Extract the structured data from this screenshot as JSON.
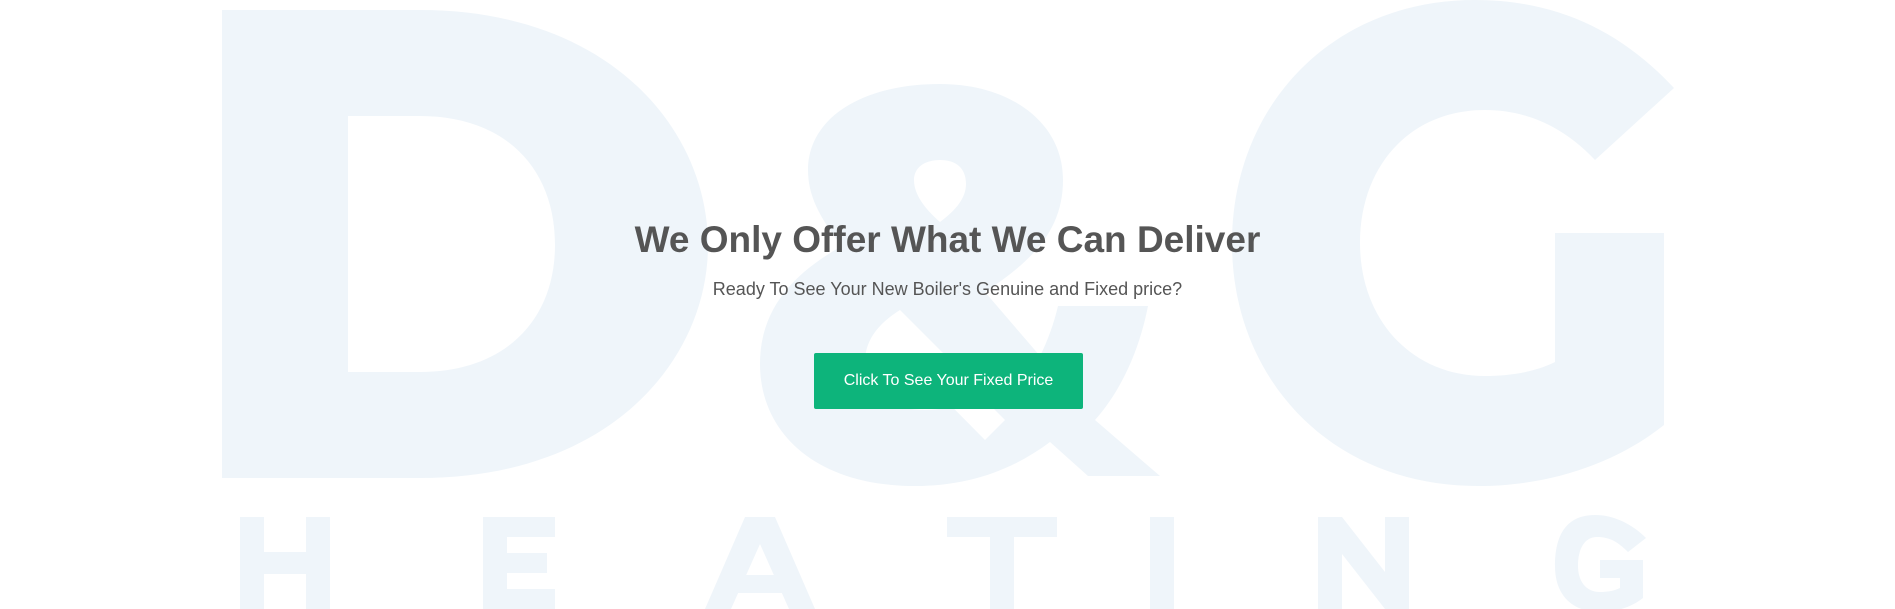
{
  "watermark": {
    "logo_mark": "D&G",
    "logo_word": "HEATING",
    "letters": [
      "H",
      "E",
      "A",
      "T",
      "I",
      "N",
      "G"
    ],
    "color": "#eff5fa"
  },
  "hero": {
    "title": "We Only Offer What We Can Deliver",
    "subtitle": "Ready To See Your New Boiler's Genuine and Fixed price?",
    "text_color": "#555555"
  },
  "cta": {
    "label": "Click To See Your Fixed Price",
    "background": "#0db47b",
    "text_color": "#ffffff"
  }
}
